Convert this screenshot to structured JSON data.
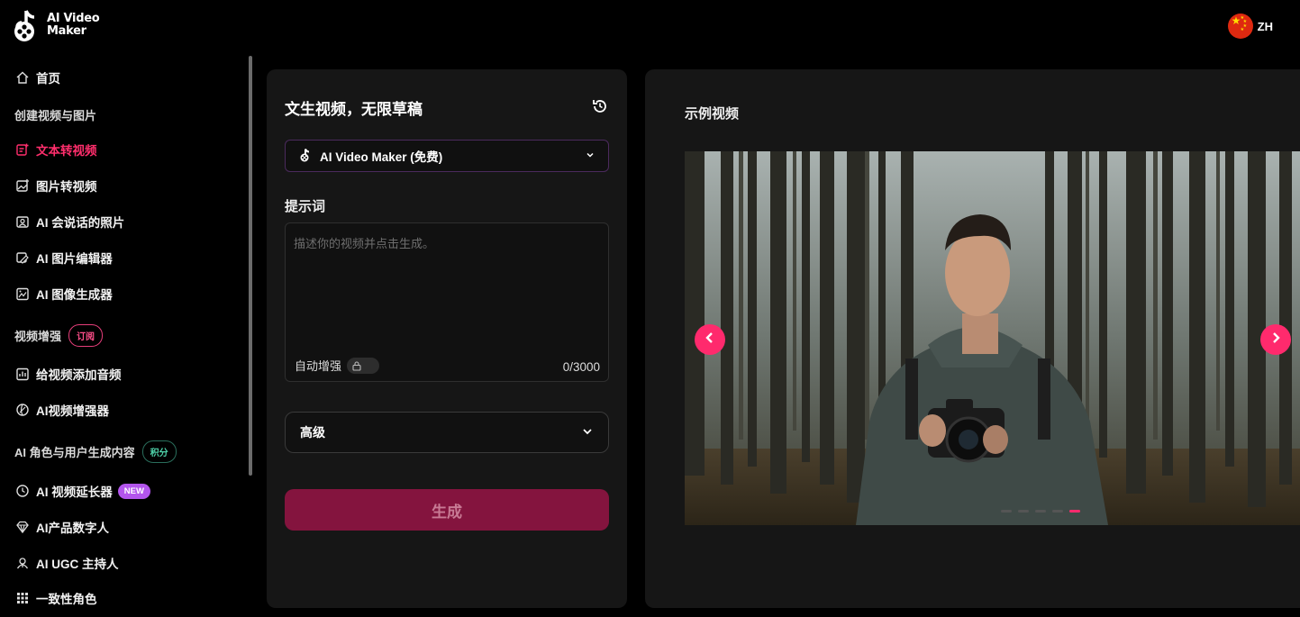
{
  "brand": {
    "name_line1": "AI Video",
    "name_line2": "Maker"
  },
  "language": {
    "code": "ZH"
  },
  "sidebar": {
    "home": "首页",
    "section_create": "创建视频与图片",
    "items_create": [
      {
        "label": "文本转视频",
        "icon": "text-video-icon"
      },
      {
        "label": "图片转视频",
        "icon": "image-video-icon"
      },
      {
        "label": "AI 会说话的照片",
        "icon": "talking-photo-icon"
      },
      {
        "label": "AI 图片编辑器",
        "icon": "image-editor-icon"
      },
      {
        "label": "AI 图像生成器",
        "icon": "image-generator-icon"
      }
    ],
    "section_enhance": "视频增强",
    "enhance_badge": "订阅",
    "items_enhance": [
      {
        "label": "给视频添加音频",
        "icon": "add-audio-icon"
      },
      {
        "label": "AI视频增强器",
        "icon": "video-enhancer-icon"
      }
    ],
    "section_ugc": "AI 角色与用户生成内容",
    "ugc_badge": "积分",
    "items_ugc": [
      {
        "label": "AI 视频延长器",
        "icon": "video-extender-icon",
        "badge": "NEW"
      },
      {
        "label": "AI产品数字人",
        "icon": "product-avatar-icon"
      },
      {
        "label": "AI UGC 主持人",
        "icon": "ugc-host-icon"
      },
      {
        "label": "一致性角色",
        "icon": "consistent-character-icon"
      }
    ]
  },
  "form": {
    "title": "文生视频，无限草稿",
    "model_value": "AI Video Maker (免费)",
    "prompt_label": "提示词",
    "prompt_placeholder": "描述你的视频并点击生成。",
    "prompt_value": "",
    "auto_enhance_label": "自动增强",
    "char_count": "0/3000",
    "advanced_label": "高级",
    "generate_label": "生成"
  },
  "preview": {
    "title": "示例视频",
    "slides_total": 5,
    "active_slide": 5
  },
  "colors": {
    "accent": "#ff2e6c",
    "generate_bg": "#84143e",
    "panel_bg": "#161616",
    "page_bg": "#000000"
  }
}
